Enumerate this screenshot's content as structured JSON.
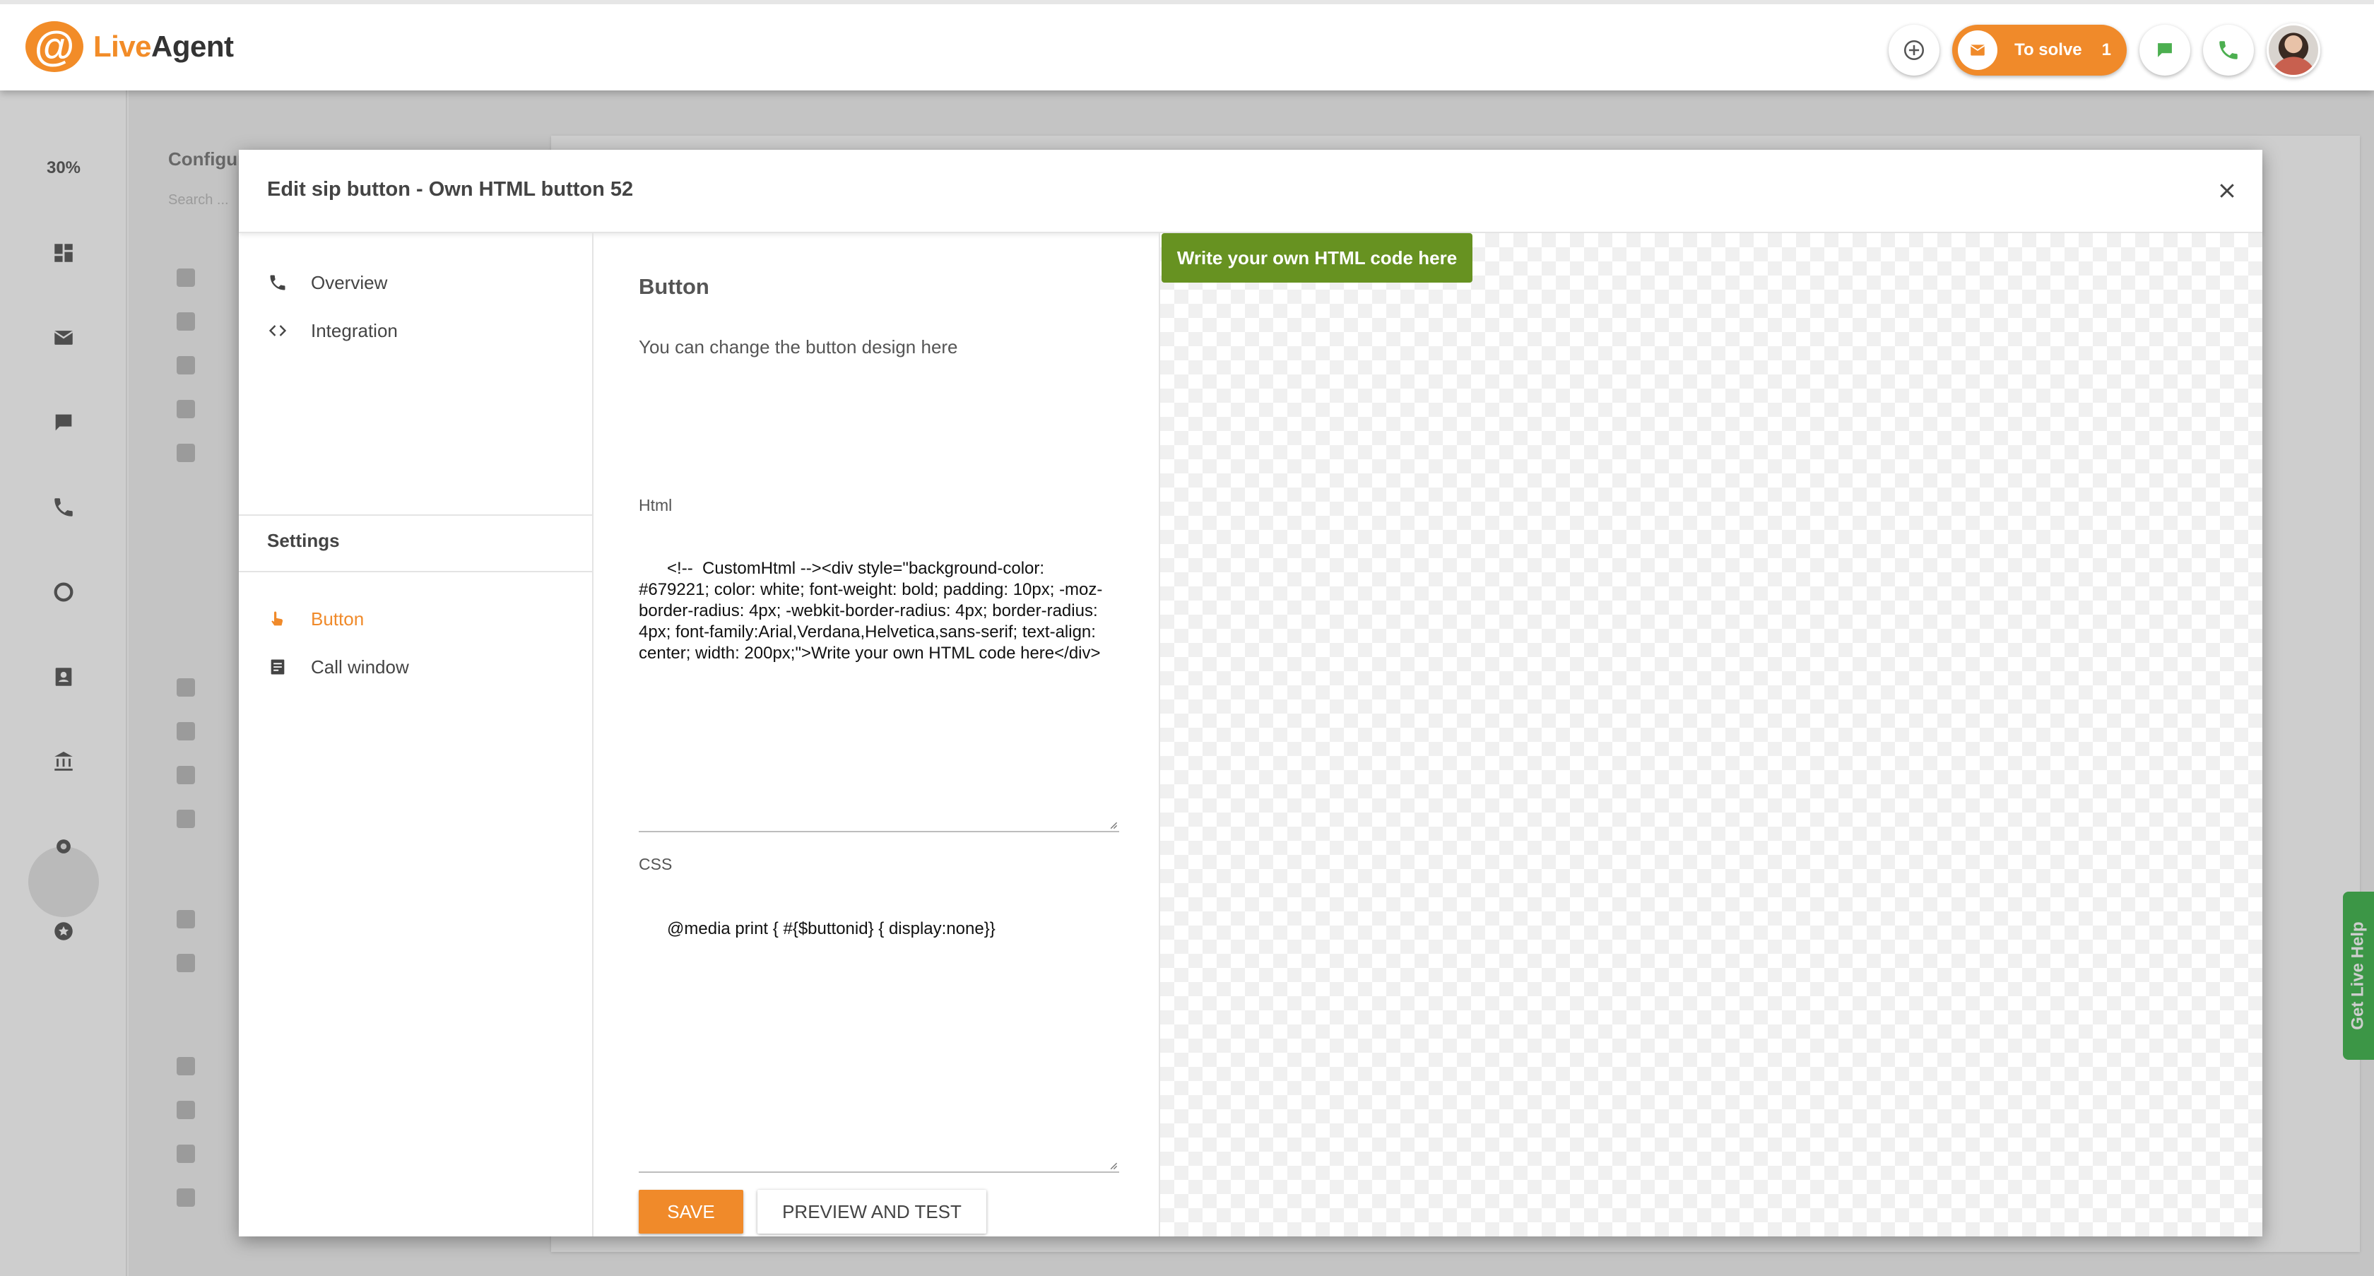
{
  "app": {
    "logo_live": "Live",
    "logo_agent": "Agent",
    "brand_color": "#f28c28"
  },
  "topbar": {
    "add_icon": "plus-circle-icon",
    "to_solve_label": "To solve",
    "to_solve_count": "1",
    "chat_icon": "chat-icon",
    "phone_icon": "phone-icon"
  },
  "rail": {
    "percent": "30%",
    "icons": [
      "dashboard-icon",
      "mail-icon",
      "chat-icon",
      "phone-icon",
      "reports-icon",
      "contacts-icon",
      "knowledgebase-icon",
      "settings-icon",
      "plugins-icon"
    ]
  },
  "background": {
    "config_title": "Configur",
    "search_placeholder": "Search ...",
    "help_tab": "Get Live Help"
  },
  "modal": {
    "title": "Edit sip button - Own HTML button 52",
    "nav": {
      "overview": "Overview",
      "integration": "Integration",
      "settings_heading": "Settings",
      "button": "Button",
      "call_window": "Call window"
    },
    "form": {
      "title": "Button",
      "description": "You can change the button design here",
      "html_label": "Html",
      "html_value": "<!--  CustomHtml --><div style=\"background-color: #679221; color: white; font-weight: bold; padding: 10px; -moz-border-radius: 4px; -webkit-border-radius: 4px; border-radius: 4px; font-family:Arial,Verdana,Helvetica,sans-serif; text-align: center; width: 200px;\">Write your own HTML code here</div>",
      "css_label": "CSS",
      "css_value": "@media print { #{$buttonid} { display:none}}",
      "save_label": "SAVE",
      "preview_label": "PREVIEW AND TEST"
    },
    "preview": {
      "button_text": "Write your own HTML code here",
      "button_color": "#679221"
    }
  }
}
